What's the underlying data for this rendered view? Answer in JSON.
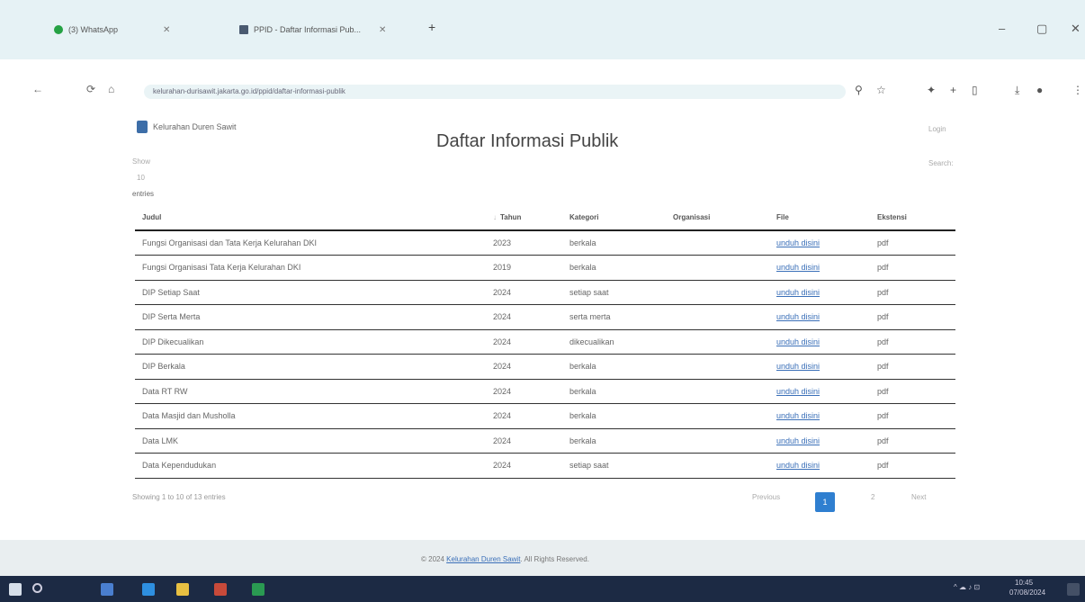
{
  "browser": {
    "tabs": [
      {
        "label": "(3) WhatsApp",
        "color": "#25a244"
      },
      {
        "label": "PPID - Daftar Informasi Pub...",
        "color": "#4a5a70"
      }
    ],
    "url": "kelurahan-durisawit.jakarta.go.id/ppid/daftar-informasi-publik"
  },
  "site": {
    "brand": "Kelurahan Duren Sawit",
    "login": "Login"
  },
  "page": {
    "title": "Daftar Informasi Publik",
    "show_label": "Show",
    "show_value": "10",
    "entries_label": "entries",
    "search_label": "Search:"
  },
  "table": {
    "headers": [
      "Judul",
      "Tahun",
      "Kategori",
      "Organisasi",
      "File",
      "Ekstensi"
    ],
    "rows": [
      {
        "judul": "Fungsi Organisasi dan Tata Kerja Kelurahan DKI",
        "tahun": "2023",
        "kategori": "berkala",
        "organisasi": "",
        "file": "unduh disini",
        "ekstensi": "pdf"
      },
      {
        "judul": "Fungsi Organisasi Tata Kerja Kelurahan DKI",
        "tahun": "2019",
        "kategori": "berkala",
        "organisasi": "",
        "file": "unduh disini",
        "ekstensi": "pdf"
      },
      {
        "judul": "DIP Setiap Saat",
        "tahun": "2024",
        "kategori": "setiap saat",
        "organisasi": "",
        "file": "unduh disini",
        "ekstensi": "pdf"
      },
      {
        "judul": "DIP Serta Merta",
        "tahun": "2024",
        "kategori": "serta merta",
        "organisasi": "",
        "file": "unduh disini",
        "ekstensi": "pdf"
      },
      {
        "judul": "DIP Dikecualikan",
        "tahun": "2024",
        "kategori": "dikecualikan",
        "organisasi": "",
        "file": "unduh disini",
        "ekstensi": "pdf"
      },
      {
        "judul": "DIP Berkala",
        "tahun": "2024",
        "kategori": "berkala",
        "organisasi": "",
        "file": "unduh disini",
        "ekstensi": "pdf"
      },
      {
        "judul": "Data RT RW",
        "tahun": "2024",
        "kategori": "berkala",
        "organisasi": "",
        "file": "unduh disini",
        "ekstensi": "pdf"
      },
      {
        "judul": "Data Masjid dan Musholla",
        "tahun": "2024",
        "kategori": "berkala",
        "organisasi": "",
        "file": "unduh disini",
        "ekstensi": "pdf"
      },
      {
        "judul": "Data LMK",
        "tahun": "2024",
        "kategori": "berkala",
        "organisasi": "",
        "file": "unduh disini",
        "ekstensi": "pdf"
      },
      {
        "judul": "Data Kependudukan",
        "tahun": "2024",
        "kategori": "setiap saat",
        "organisasi": "",
        "file": "unduh disini",
        "ekstensi": "pdf"
      }
    ]
  },
  "pagination": {
    "info": "Showing 1 to 10 of 13 entries",
    "previous": "Previous",
    "page1": "1",
    "page2": "2",
    "next": "Next"
  },
  "footer": {
    "prefix": "© 2024",
    "link": "Kelurahan Duren Sawit",
    "suffix": ". All Rights Reserved."
  },
  "taskbar": {
    "time": "10:45",
    "date": "07/08/2024"
  }
}
